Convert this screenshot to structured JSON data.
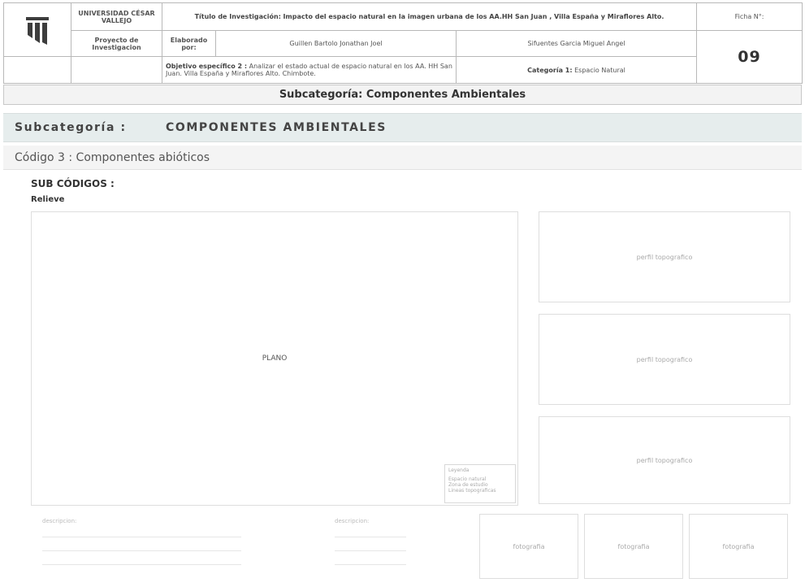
{
  "header": {
    "university": "UNIVERSIDAD CÉSAR VALLEJO",
    "title_label": "Título de Investigación:",
    "title_text": "Impacto del espacio natural en la imagen urbana de los AA.HH San Juan , Villa España y Miraflores Alto.",
    "ficha_label": "Ficha N°:",
    "ficha_number": "09",
    "project": "Proyecto de Investigacion",
    "elaborado": "Elaborado por:",
    "author1": "Guillen Bartolo Jonathan Joel",
    "author2": "Sifuentes Garcia Miguel Angel",
    "objective_label": "Objetivo específico 2 :",
    "objective_text": "Analizar el estado actual de espacio natural en los AA. HH San Juan. Villa España y Miraflores Alto. Chimbote.",
    "category_label": "Categoría 1:",
    "category_text": "Espacio Natural"
  },
  "banner": {
    "subcategory": "Subcategoría: Componentes Ambientales"
  },
  "subcategory_row": {
    "label": "Subcategoría :",
    "value": "COMPONENTES AMBIENTALES"
  },
  "codigo": {
    "text": "Código 3 : Componentes abióticos"
  },
  "sub_codigos": {
    "label": "SUB CÓDIGOS :",
    "relieve": "Relieve"
  },
  "plano": {
    "label": "PLANO",
    "legend_title": "Leyenda",
    "legend_items": [
      "Espacio natural",
      "Zona de estudio",
      "Lineas topograficas"
    ]
  },
  "profiles": [
    "perfil topografico",
    "perfil topografico",
    "perfil topografico"
  ],
  "descriptions": [
    "descripcion:",
    "descripcion:"
  ],
  "photos": [
    "fotografia",
    "fotografia",
    "fotografia"
  ],
  "colors": {
    "accent_band": "#e6eded",
    "border": "#b8b8b8"
  }
}
